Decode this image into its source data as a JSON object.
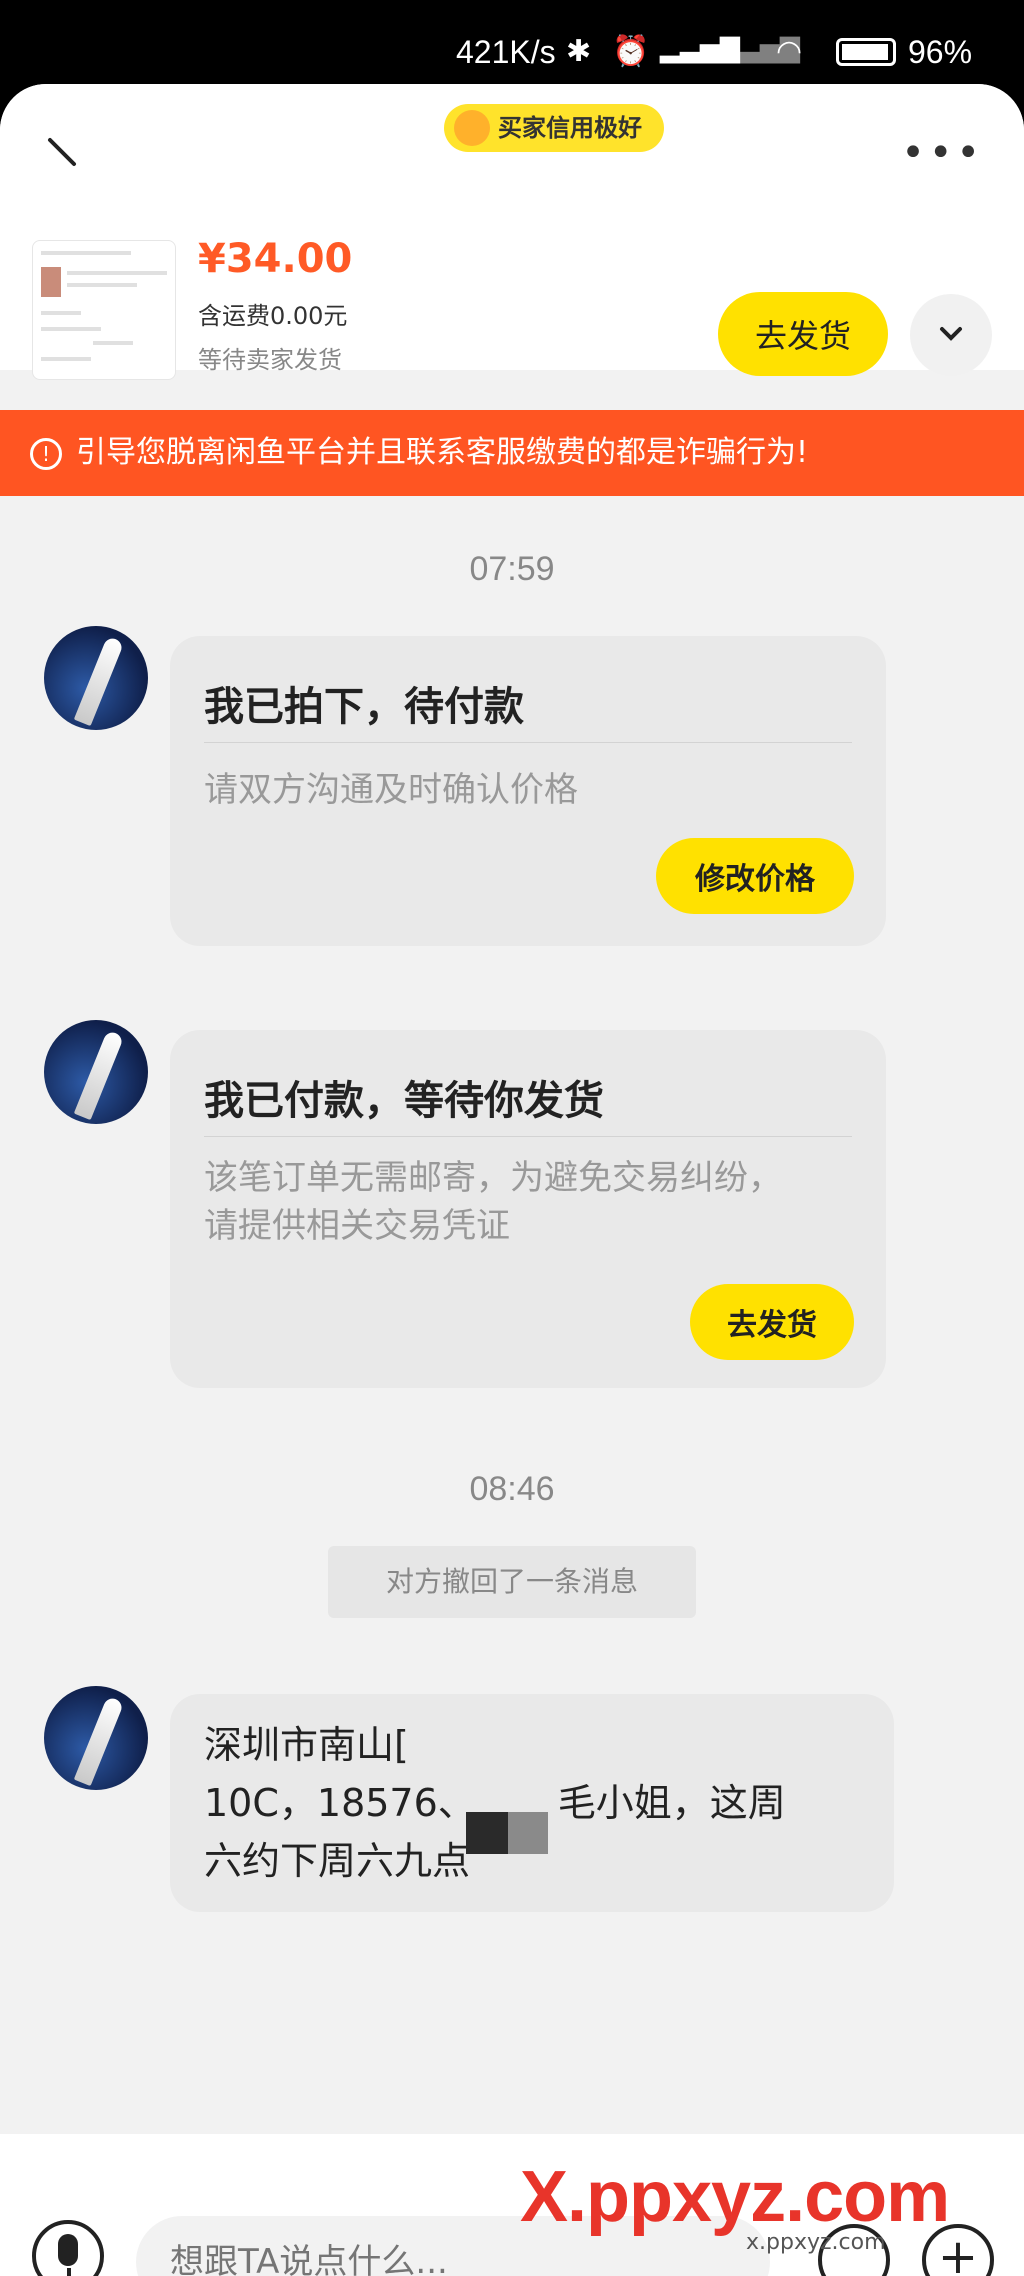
{
  "status_bar": {
    "net_speed": "421K/s",
    "battery": "96%"
  },
  "header": {
    "credit_badge": "买家信用极好",
    "more_icon": "more-dots-icon"
  },
  "order": {
    "price": "¥34.00",
    "shipping": "含运费0.00元",
    "status": "等待卖家发货",
    "ship_button": "去发货"
  },
  "warning": {
    "text": "引导您脱离闲鱼平台并且联系客服缴费的都是诈骗行为!"
  },
  "messages": {
    "time1": "07:59",
    "card1": {
      "title": "我已拍下，待付款",
      "desc": "请双方沟通及时确认价格",
      "button": "修改价格"
    },
    "card2": {
      "title": "我已付款，等待你发货",
      "desc_line1": "该笔订单无需邮寄，为避免交易纠纷，",
      "desc_line2": "请提供相关交易凭证",
      "button": "去发货"
    },
    "time2": "08:46",
    "recall_notice": "对方撤回了一条消息",
    "bubble": {
      "line1": "深圳市南山[",
      "line2": "10C，18576、",
      "line2_tail": "毛小姐，这周",
      "line3": "六约下周六九点"
    }
  },
  "footer": {
    "input_placeholder": "想跟TA说点什么..."
  },
  "watermark": {
    "main": "X.ppxyz.com",
    "small": "x.ppxyz.com"
  },
  "colors": {
    "accent": "#ffe100",
    "warning": "#ff5522",
    "price": "#ff5a26"
  }
}
